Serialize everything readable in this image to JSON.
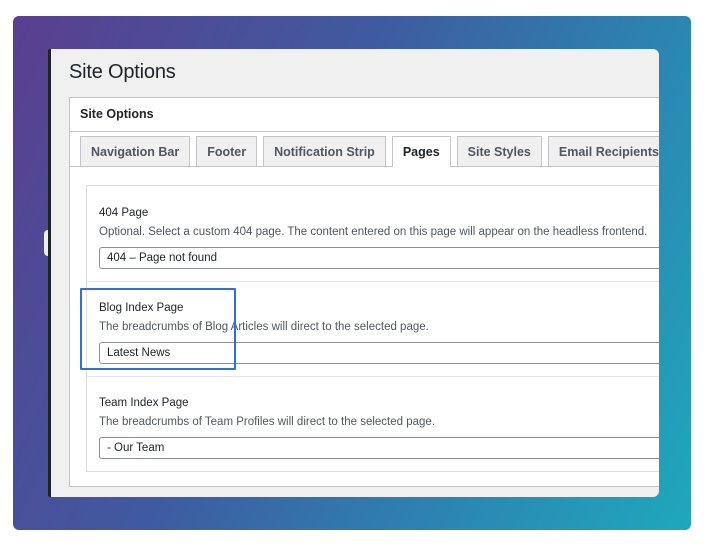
{
  "window": {
    "page_title": "Site Options"
  },
  "panel": {
    "title": "Site Options",
    "collapse_icon": "chevron-up-icon"
  },
  "tabs": [
    {
      "label": "Navigation Bar",
      "active": false
    },
    {
      "label": "Footer",
      "active": false
    },
    {
      "label": "Notification Strip",
      "active": false
    },
    {
      "label": "Pages",
      "active": true
    },
    {
      "label": "Site Styles",
      "active": false
    },
    {
      "label": "Email Recipients",
      "active": false
    }
  ],
  "fields": [
    {
      "label": "404 Page",
      "description": "Optional. Select a custom 404 page. The content entered on this page will appear on the headless frontend.",
      "value": "404 – Page not found"
    },
    {
      "label": "Blog Index Page",
      "description": "The breadcrumbs of Blog Articles will direct to the selected page.",
      "value": "Latest News"
    },
    {
      "label": "Team Index Page",
      "description": "The breadcrumbs of Team Profiles will direct to the selected page.",
      "value": "- Our Team"
    }
  ],
  "colors": {
    "highlight": "#2f6fdd",
    "gradient_start": "#5a3f8f",
    "gradient_end": "#1fa8bd"
  }
}
